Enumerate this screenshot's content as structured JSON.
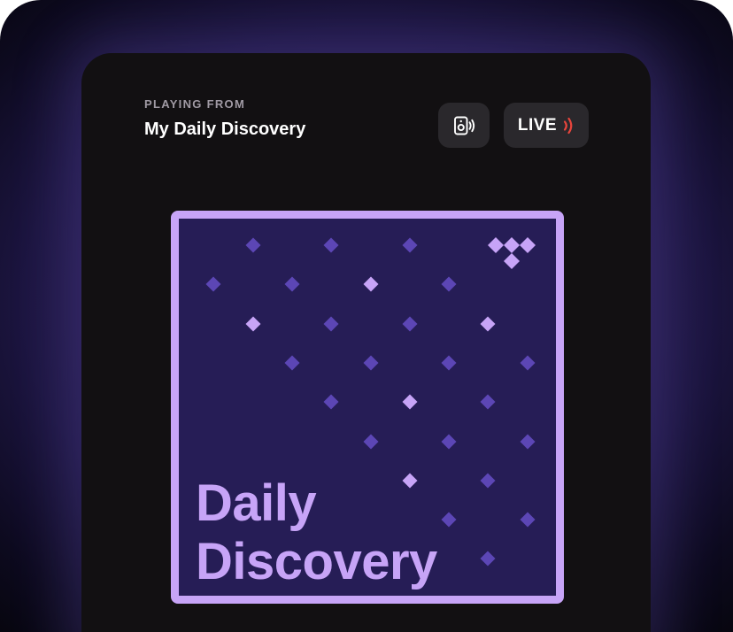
{
  "header": {
    "playing_from_label": "PLAYING FROM",
    "playlist_name": "My Daily Discovery"
  },
  "controls": {
    "cast_icon": "speaker-cast-icon",
    "live_label": "LIVE",
    "live_icon": "broadcast-waves-icon"
  },
  "artwork": {
    "title_line1": "Daily",
    "title_line2": "Discovery",
    "logo_icon": "tidal-logo-icon"
  },
  "colors": {
    "background": "#121012",
    "accent": "#c7a4f7",
    "artwork_bg": "#261d56",
    "dim_diamond": "#5c46b5",
    "live_red": "#e8453c"
  }
}
